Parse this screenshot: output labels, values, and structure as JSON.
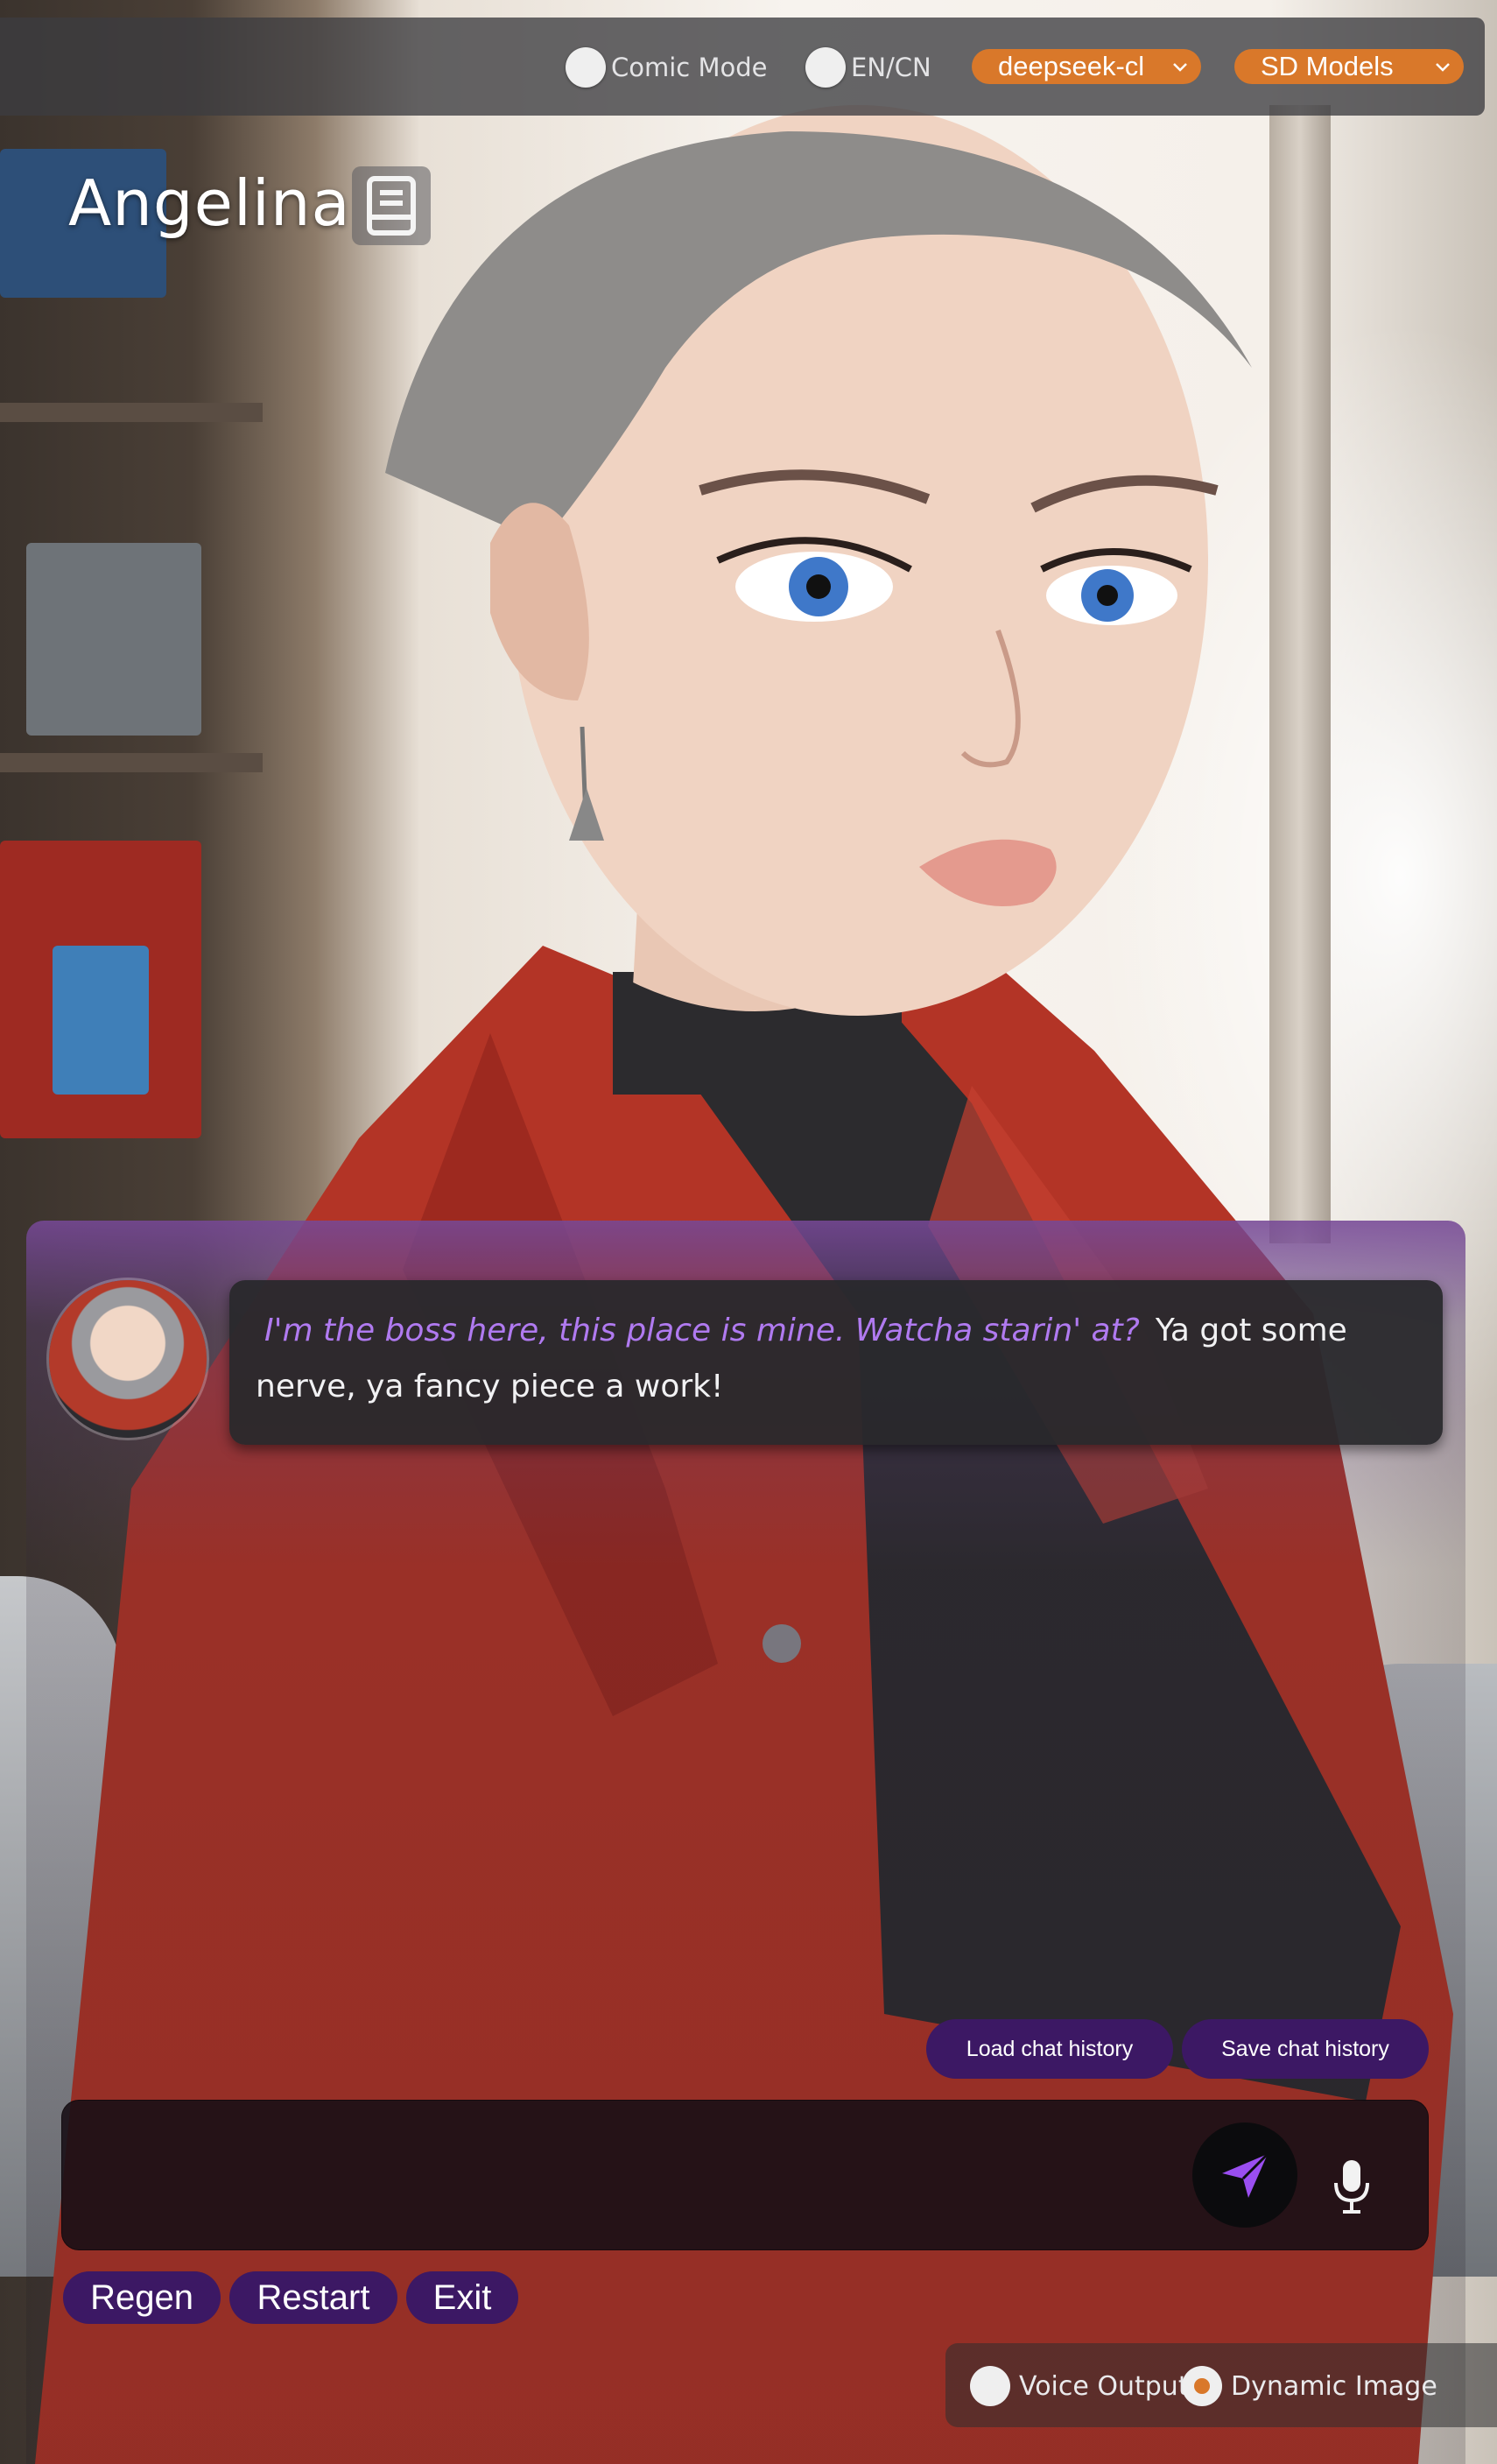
{
  "topbar": {
    "comic_mode_label": "Comic Mode",
    "lang_label": "EN/CN",
    "llm_select_value": "deepseek-cl",
    "sd_select_value": "SD Models"
  },
  "character": {
    "name": "Angelina"
  },
  "chat": {
    "messages": [
      {
        "role": "assistant",
        "italic_text": "I'm the boss here, this place is mine. Watcha starin' at?",
        "text": "Ya got some nerve, ya fancy piece a work!"
      }
    ],
    "load_history_label": "Load chat history",
    "save_history_label": "Save chat history",
    "input_value": "",
    "input_placeholder": ""
  },
  "actions": {
    "regen_label": "Regen",
    "restart_label": "Restart",
    "exit_label": "Exit"
  },
  "options": {
    "voice_output_label": "Voice Output",
    "voice_output_on": false,
    "dynamic_image_label": "Dynamic Image",
    "dynamic_image_on": true
  },
  "colors": {
    "accent_orange": "#d9782a",
    "button_purple": "#3c1864",
    "italic_purple": "#b07af0"
  },
  "icons": {
    "book": "book-icon",
    "send": "send-icon",
    "mic": "microphone-icon",
    "chevron": "chevron-down-icon"
  }
}
